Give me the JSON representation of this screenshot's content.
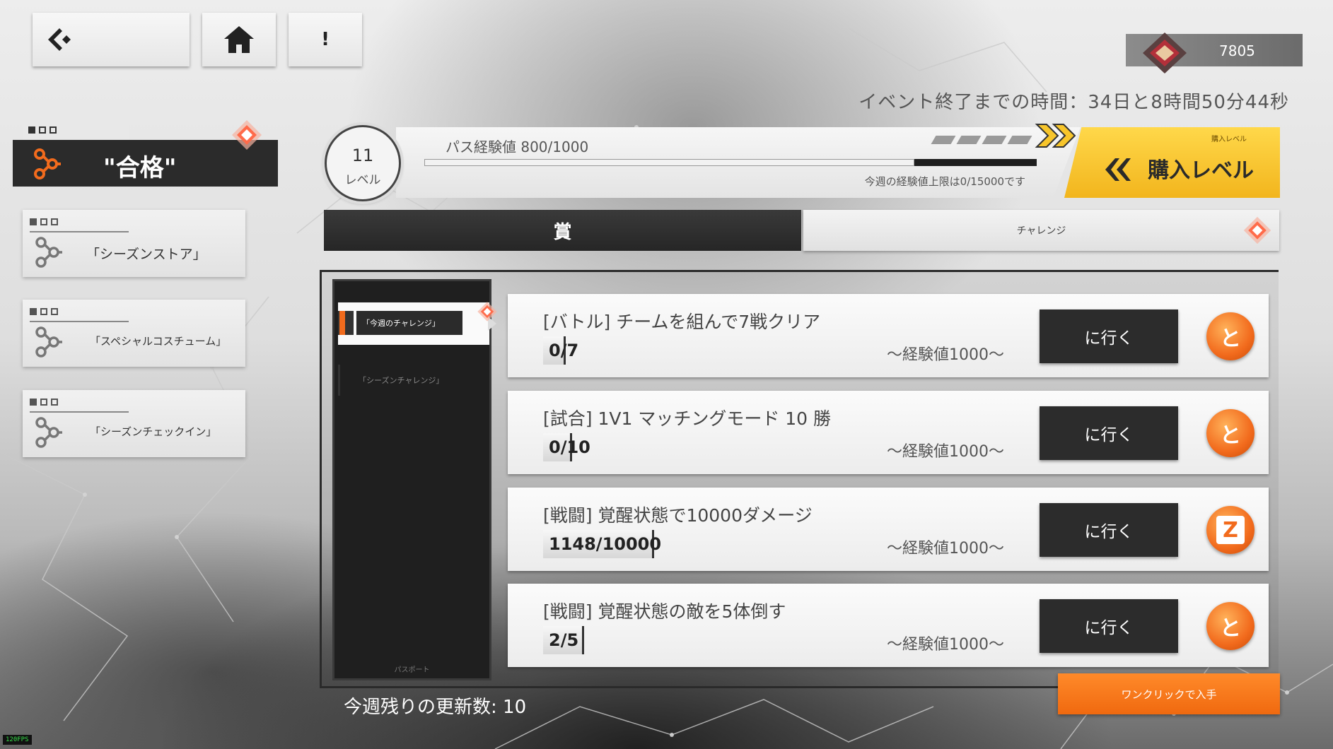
{
  "top_bar": {
    "info_label": "!"
  },
  "currency": {
    "amount": "7805"
  },
  "event_timer": "イベント終了までの時間：34日と8時間50分44秒",
  "side_menu": {
    "active_label": "\"合格\"",
    "items": [
      {
        "label": "「シーズンストア」"
      },
      {
        "label": "「スペシャルコスチューム」"
      },
      {
        "label": "「シーズンチェックイン」"
      }
    ]
  },
  "pass": {
    "level": "11",
    "level_caption": "レベル",
    "exp_label": "パス経験値 800/1000",
    "exp_progress": 0.8,
    "weekly_limit": "今週の経験値上限は0/15000です",
    "buy_small": "購入レベル",
    "buy_label": "購入レベル"
  },
  "tabs": {
    "reward": "賞",
    "challenge": "チャレンジ"
  },
  "sub_nav": {
    "active": "「今週のチャレンジ」",
    "other": "「シーズンチャレンジ」",
    "footer": "パスポート"
  },
  "challenges": [
    {
      "title": "[バトル] チームを組んで7戦クリア",
      "progress": "0/7",
      "fraction": 0,
      "reward": "～経験値1000～",
      "go": "に行く",
      "coin": "と"
    },
    {
      "title": "[試合] 1V1 マッチングモード 10 勝",
      "progress": "0/10",
      "fraction": 0,
      "reward": "～経験値1000～",
      "go": "に行く",
      "coin": "と"
    },
    {
      "title": "[戦闘] 覚醒状態で10000ダメージ",
      "progress": "1148/10000",
      "fraction": 0.1148,
      "reward": "～経験値1000～",
      "go": "に行く",
      "coin": "Z"
    },
    {
      "title": "[戦闘] 覚醒状態の敵を5体倒す",
      "progress": "2/5",
      "fraction": 0.4,
      "reward": "～経験値1000～",
      "go": "に行く",
      "coin": "と"
    }
  ],
  "refresh_remaining": "今週残りの更新数: 10",
  "claim_all": "ワンクリックで入手",
  "fps": "120FPS",
  "colors": {
    "accent_orange": "#f26b1d",
    "buy_yellow": "#f7c52b",
    "dark_panel": "#2b2b2b"
  }
}
